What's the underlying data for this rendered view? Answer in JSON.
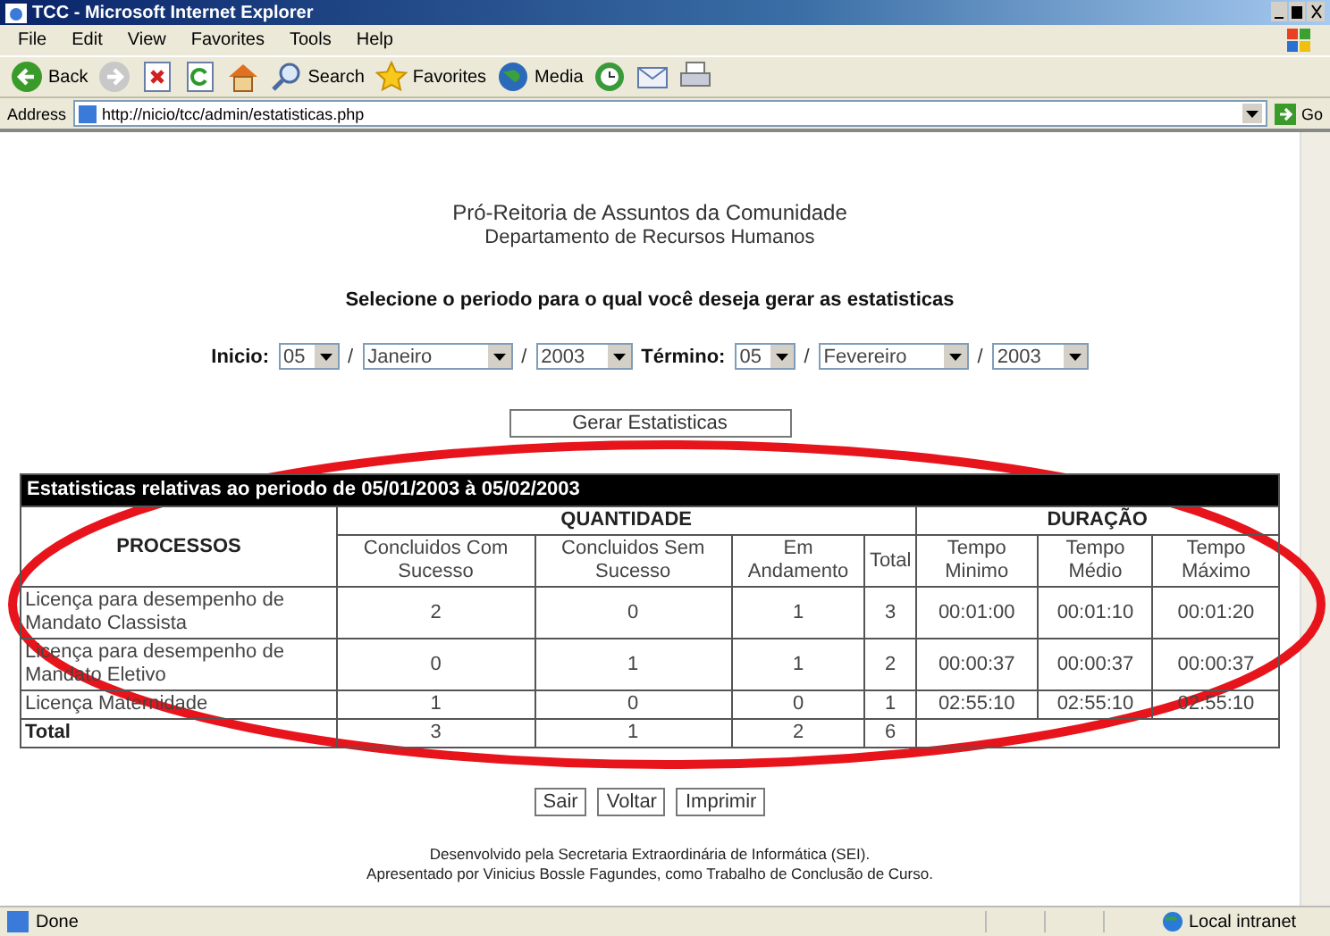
{
  "window": {
    "title": "TCC - Microsoft Internet Explorer"
  },
  "menu": [
    "File",
    "Edit",
    "View",
    "Favorites",
    "Tools",
    "Help"
  ],
  "toolbar": [
    {
      "kind": "back",
      "label": "Back"
    },
    {
      "kind": "forward"
    },
    {
      "kind": "stop"
    },
    {
      "kind": "refresh"
    },
    {
      "kind": "home"
    },
    {
      "kind": "search",
      "label": "Search"
    },
    {
      "kind": "favorites",
      "label": "Favorites"
    },
    {
      "kind": "media",
      "label": "Media"
    },
    {
      "kind": "history"
    },
    {
      "kind": "mail"
    },
    {
      "kind": "print"
    }
  ],
  "address": {
    "label": "Address",
    "value": "http://nicio/tcc/admin/estatisticas.php",
    "go": "Go"
  },
  "page": {
    "header": [
      "Pró-Reitoria de Assuntos da Comunidade",
      "Departamento de Recursos Humanos"
    ],
    "prompt": "Selecione o periodo para o qual você deseja gerar as estatisticas",
    "period": {
      "separator": "/",
      "start_label": "Inicio:",
      "start": [
        "05",
        "Janeiro",
        "2003"
      ],
      "end_label": "Término:",
      "end": [
        "05",
        "Fevereiro",
        "2003"
      ]
    },
    "generate_button": "Gerar Estatisticas",
    "table": {
      "caption": "Estatisticas relativas ao periodo de 05/01/2003 à 05/02/2003",
      "process_header": "PROCESSOS",
      "groups": [
        "QUANTIDADE",
        "DURAÇÃO"
      ],
      "columns": [
        "Concluidos Com Sucesso",
        "Concluidos Sem Sucesso",
        "Em Andamento",
        "Total",
        "Tempo Minimo",
        "Tempo Médio",
        "Tempo Máximo"
      ],
      "rows": [
        {
          "name": "Licença para desempenho de Mandato Classista",
          "cells": [
            "2",
            "0",
            "1",
            "3",
            "00:01:00",
            "00:01:10",
            "00:01:20"
          ]
        },
        {
          "name": "Licença para desempenho de Mandato Eletivo",
          "cells": [
            "0",
            "1",
            "1",
            "2",
            "00:00:37",
            "00:00:37",
            "00:00:37"
          ]
        },
        {
          "name": "Licença Maternidade",
          "cells": [
            "1",
            "0",
            "0",
            "1",
            "02:55:10",
            "02:55:10",
            "02:55:10"
          ]
        }
      ],
      "total": {
        "label": "Total",
        "cells": [
          "3",
          "1",
          "2",
          "6"
        ]
      }
    },
    "buttons": [
      "Sair",
      "Voltar",
      "Imprimir"
    ],
    "footer": [
      "Desenvolvido pela Secretaria Extraordinária de Informática (SEI).",
      "Apresentado por Vinicius Bossle Fagundes, como Trabalho de Conclusão de Curso."
    ]
  },
  "status": {
    "text": "Done",
    "zone": "Local intranet"
  }
}
